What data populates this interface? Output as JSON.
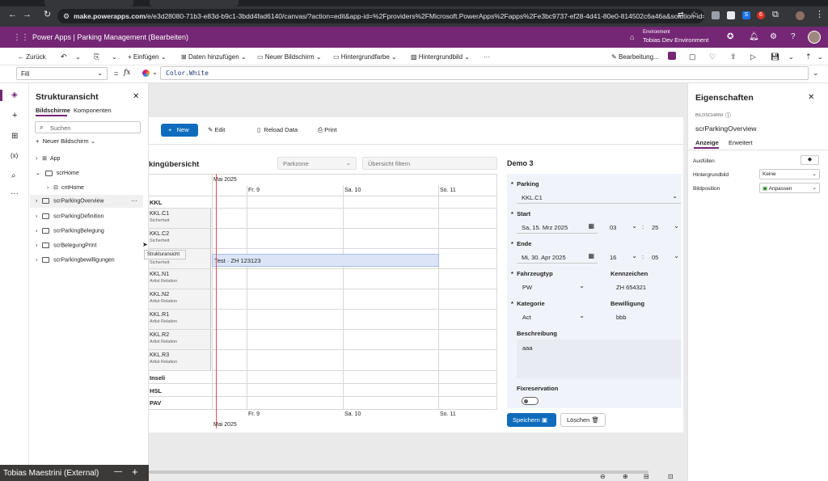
{
  "browser": {
    "url_domain": "make.powerapps.com",
    "url_rest": "/e/e3d28080-71b3-e83d-b9c1-3bdd4fad6140/canvas/?action=edit&app-id=%2Fproviders%2FMicrosoft.PowerApps%2Fapps%2Fe3bc9737-ef28-4d41-80e0-814502c6a46a&solution-id=...",
    "ext_s": "S",
    "ext_count": "6"
  },
  "app_header": {
    "title": "Power Apps  |  Parking Management (Bearbeiten)",
    "env_label": "Environment",
    "env_name": "Tobias Dev Environment"
  },
  "command_bar": {
    "back": "Zurück",
    "insert": "Einfügen",
    "add_data": "Daten hinzufügen",
    "new_screen": "Neuer Bildschirm",
    "background_color": "Hintergrundfarbe",
    "background_image": "Hintergrundbild",
    "more": "···",
    "edit_mode": "Bearbeitung..."
  },
  "formula": {
    "property": "Fill",
    "fx": "fx",
    "equals": "=",
    "value": "Color.White"
  },
  "tree": {
    "title": "Strukturansicht",
    "tab_screens": "Bildschirme",
    "tab_components": "Komponenten",
    "search_placeholder": "Suchen",
    "new_screen": "Neuer Bildschirm",
    "items": [
      {
        "label": "App"
      },
      {
        "label": "scrHome"
      },
      {
        "label": "cntHome"
      },
      {
        "label": "scrParkingOverview"
      },
      {
        "label": "scrParkingDefinition"
      },
      {
        "label": "scrParkingBelegung"
      },
      {
        "label": "scrBelegungPrint"
      },
      {
        "label": "scrParkingbewilligungen"
      }
    ],
    "tooltip": "Strukturansicht"
  },
  "canvas": {
    "btn_new": "New",
    "btn_edit": "Edit",
    "btn_reload": "Reload Data",
    "btn_print": "Print",
    "overview_title": "kingübersicht",
    "parkzone_placeholder": "Parkzone",
    "filter_placeholder": "Übersicht filtern",
    "month": "Mai 2025",
    "days": [
      "Fr. 9",
      "Sa. 10",
      "So. 11"
    ],
    "rows": [
      {
        "name": "KKL",
        "sub": ""
      },
      {
        "name": "KKL.C1",
        "sub": "Sicherheit"
      },
      {
        "name": "KKL.C2",
        "sub": "Sicherheit"
      },
      {
        "name": "",
        "sub": "Sicherheit"
      },
      {
        "name": "KKL.N1",
        "sub": "Artist Relation"
      },
      {
        "name": "KKL.N2",
        "sub": "Artist Relation"
      },
      {
        "name": "KKL.R1",
        "sub": "Artist Relation"
      },
      {
        "name": "KKL.R2",
        "sub": "Artist Relation"
      },
      {
        "name": "KKL.R3",
        "sub": "Artist Relation"
      },
      {
        "name": "Inseli",
        "sub": ""
      },
      {
        "name": "HSL",
        "sub": ""
      },
      {
        "name": "PAV",
        "sub": ""
      }
    ],
    "booking": "Test · ZH 123123"
  },
  "form": {
    "title": "Demo 3",
    "parking_label": "Parking",
    "parking_value": "KKL.C1",
    "start_label": "Start",
    "start_date": "Sa, 15. Mrz 2025",
    "start_hour": "03",
    "start_min": "25",
    "end_label": "Ende",
    "end_date": "Mi, 30. Apr 2025",
    "end_hour": "16",
    "end_min": "05",
    "vehicle_type_label": "Fahrzeugtyp",
    "vehicle_type_value": "PW",
    "plate_label": "Kennzeichen",
    "plate_value": "ZH 654321",
    "category_label": "Kategorie",
    "category_value": "Act",
    "permit_label": "Bewilligung",
    "permit_value": "bbb",
    "desc_label": "Beschreibung",
    "desc_value": "aaa",
    "fix_label": "Fixreservation",
    "save": "Speichern",
    "delete": "Löschen",
    "required_star": "*",
    "colon": ":"
  },
  "props": {
    "title": "Eigenschaften",
    "type": "BILDSCHIRM",
    "name": "scrParkingOverview",
    "tab_display": "Anzeige",
    "tab_advanced": "Erweitert",
    "fill_label": "Ausfüllen",
    "bg_image_label": "Hintergrundbild",
    "bg_image_value": "Keine",
    "bg_pos_label": "Bildposition",
    "bg_pos_value": "Anpassen"
  },
  "bottom": {
    "name": "Tobias Maestrini (External)",
    "minus": "—",
    "plus": "+"
  },
  "colors": {
    "header": "#742774",
    "accent": "#0f6cbd",
    "timeline_marker": "#e05050"
  }
}
